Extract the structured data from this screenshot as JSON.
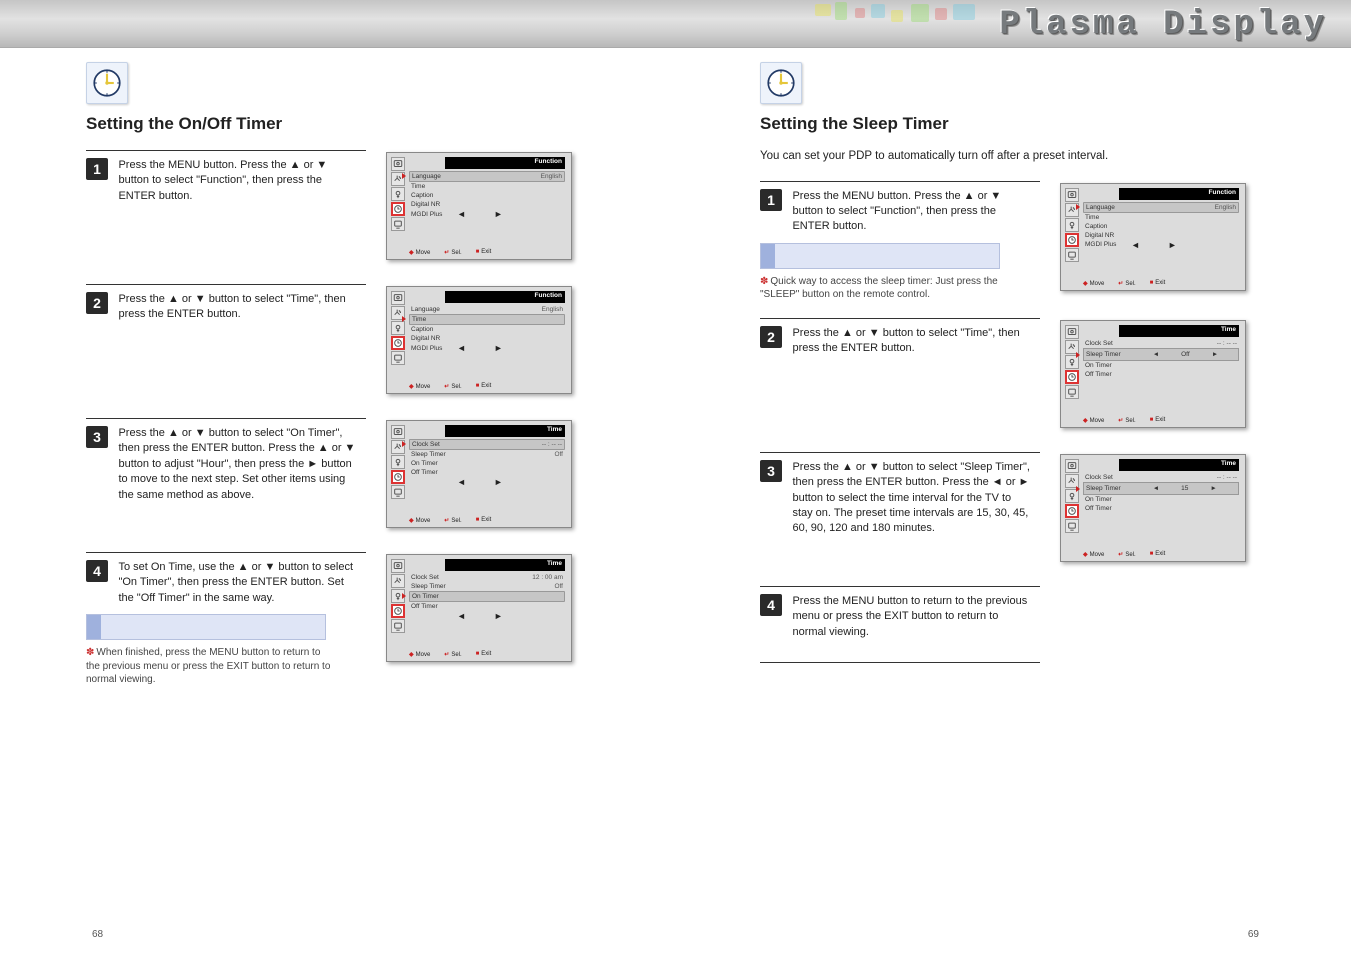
{
  "banner": {
    "title": "Plasma Display"
  },
  "left": {
    "heading": "Setting the On/Off Timer",
    "steps": [
      {
        "num": "1",
        "text_html": "Press the MENU button. Press the ▲ or ▼ button to select \"Function\", then press the ENTER button.",
        "osd": {
          "title": "Function",
          "rows": [
            {
              "label": "Language",
              "value": "English",
              "active": true,
              "arrow": true
            },
            {
              "label": "Time",
              "value": ""
            },
            {
              "label": "Caption",
              "value": ""
            },
            {
              "label": "Digital NR",
              "value": ""
            },
            {
              "label": "MGDI Plus",
              "value": ""
            }
          ],
          "lrnav": true,
          "highlight_tab": 3,
          "footer": [
            "Move",
            "Sel.",
            "Exit"
          ]
        }
      },
      {
        "num": "2",
        "text_html": "Press the ▲ or ▼ button to select \"Time\", then press the ENTER button.",
        "osd": {
          "title": "Function",
          "rows": [
            {
              "label": "Language",
              "value": "English"
            },
            {
              "label": "Time",
              "value": "",
              "active": true,
              "arrow": true
            },
            {
              "label": "Caption",
              "value": ""
            },
            {
              "label": "Digital NR",
              "value": ""
            },
            {
              "label": "MGDI Plus",
              "value": ""
            }
          ],
          "lrnav": true,
          "highlight_tab": 3,
          "footer": [
            "Move",
            "Sel.",
            "Exit"
          ]
        }
      },
      {
        "num": "3",
        "text_html": "Press the ▲ or ▼ button to select \"On Timer\", then press the ENTER button. Press the ▲ or ▼ button to adjust \"Hour\", then press the ► button to move to the next step. Set other items using the same method as above.",
        "osd": {
          "title": "Time",
          "rows": [
            {
              "label": "Clock Set",
              "value": "-- : -- --",
              "active": true,
              "arrow": true
            },
            {
              "label": "Sleep Timer",
              "value": "Off"
            },
            {
              "label": "On Timer",
              "value": ""
            },
            {
              "label": "Off Timer",
              "value": ""
            }
          ],
          "lrnav": true,
          "highlight_tab": 3,
          "footer": [
            "Move",
            "Sel.",
            "Exit"
          ]
        }
      },
      {
        "num": "4",
        "text_html": "To set On Time, use the ▲ or ▼ button to select \"On Timer\", then press the ENTER button. Set the \"Off Timer\" in the same way.",
        "highlight": true,
        "note_html": "When finished, press the MENU button to return to the previous menu or press the EXIT button to return to normal viewing.",
        "osd": {
          "title": "Time",
          "rows": [
            {
              "label": "Clock Set",
              "value": "12 : 00 am"
            },
            {
              "label": "Sleep Timer",
              "value": "Off"
            },
            {
              "label": "On Timer",
              "value": "",
              "active": true,
              "arrow": true
            },
            {
              "label": "Off Timer",
              "value": ""
            }
          ],
          "lrnav": true,
          "highlight_tab": 3,
          "footer": [
            "Move",
            "Sel.",
            "Exit"
          ]
        }
      }
    ]
  },
  "right": {
    "heading": "Setting the Sleep Timer",
    "intro": "You can set your PDP to automatically turn off after a preset interval.",
    "steps": [
      {
        "num": "1",
        "text_html": "Press the MENU button. Press the ▲ or ▼ button to select \"Function\", then press the ENTER button.",
        "highlight": true,
        "note_html": "Quick way to access the sleep timer: Just press the \"SLEEP\" button on the remote control.",
        "osd": {
          "title": "Function",
          "rows": [
            {
              "label": "Language",
              "value": "English",
              "active": true,
              "arrow": true
            },
            {
              "label": "Time",
              "value": ""
            },
            {
              "label": "Caption",
              "value": ""
            },
            {
              "label": "Digital NR",
              "value": ""
            },
            {
              "label": "MGDI Plus",
              "value": ""
            }
          ],
          "lrnav": true,
          "highlight_tab": 3,
          "footer": [
            "Move",
            "Sel.",
            "Exit"
          ]
        }
      },
      {
        "num": "2",
        "text_html": "Press the ▲ or ▼ button to select \"Time\", then press the ENTER button.",
        "osd": {
          "title": "Time",
          "rows": [
            {
              "label": "Clock Set",
              "value": "-- : -- --"
            },
            {
              "label": "Sleep Timer",
              "value": "Off",
              "slider": true,
              "arrow": true
            },
            {
              "label": "On Timer",
              "value": ""
            },
            {
              "label": "Off Timer",
              "value": ""
            }
          ],
          "lrnav_slider": true,
          "highlight_tab": 3,
          "footer": [
            "Move",
            "Sel.",
            "Exit"
          ]
        }
      },
      {
        "num": "3",
        "text_html": "Press the ▲ or ▼ button to select \"Sleep Timer\", then press the ENTER button. Press the ◄ or ► button to select the time interval for the TV to stay on. The preset time intervals are 15, 30, 45, 60, 90, 120 and 180 minutes.",
        "osd": {
          "title": "Time",
          "rows": [
            {
              "label": "Clock Set",
              "value": "-- : -- --"
            },
            {
              "label": "Sleep Timer",
              "value": "15",
              "slider": true,
              "arrow": true
            },
            {
              "label": "On Timer",
              "value": ""
            },
            {
              "label": "Off Timer",
              "value": ""
            }
          ],
          "lrnav_slider": true,
          "highlight_tab": 3,
          "footer": [
            "Move",
            "Sel.",
            "Exit"
          ]
        }
      },
      {
        "num": "4",
        "text_html": "Press the MENU button to return to the previous menu or press the EXIT button to return to normal viewing.",
        "osd": null,
        "endrule_only": true
      }
    ]
  },
  "page_left": "68",
  "page_right": "69",
  "icon_names": {
    "tab0": "picture-icon",
    "tab1": "sound-icon",
    "tab2": "channel-icon",
    "tab3": "time-icon",
    "tab4": "setup-icon"
  }
}
